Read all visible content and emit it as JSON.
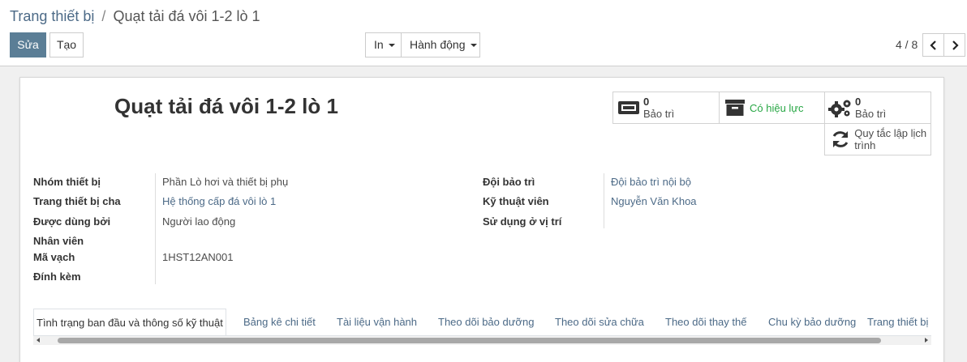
{
  "breadcrumb": {
    "parent": "Trang thiết bị",
    "separator": "/",
    "current": "Quạt tải đá vôi 1-2 lò 1"
  },
  "buttons": {
    "edit": "Sửa",
    "create": "Tạo",
    "print": "In",
    "action": "Hành động"
  },
  "pager": {
    "value": "4 / 8"
  },
  "record": {
    "title": "Quạt tải đá vôi 1-2 lò 1"
  },
  "smart_buttons": {
    "maintenance": {
      "count": "0",
      "label": "Bảo trì"
    },
    "active": {
      "label": "Có hiệu lực"
    },
    "maintenance2": {
      "count": "0",
      "label": "Bảo trì"
    },
    "schedule": {
      "label": "Quy tắc lập lịch trình"
    }
  },
  "fields_left": [
    {
      "label": "Nhóm thiết bị",
      "value": "Phần Lò hơi và thiết bị phụ"
    },
    {
      "label": "Trang thiết bị cha",
      "value": "Hệ thống cấp đá vôi lò 1"
    },
    {
      "label": "Được dùng bởi",
      "value": "Người lao động"
    },
    {
      "label": "Nhân viên",
      "value": ""
    },
    {
      "label": "Mã vạch",
      "value": "1HST12AN001"
    },
    {
      "label": "Đính kèm",
      "value": ""
    }
  ],
  "fields_right": [
    {
      "label": "Đội bảo trì",
      "value": "Đội bảo trì nội bộ"
    },
    {
      "label": "Kỹ thuật viên",
      "value": "Nguyễn Văn Khoa"
    },
    {
      "label": "Sử dụng ở vị trí",
      "value": ""
    }
  ],
  "tabs": [
    "Tình trạng ban đầu và thông số kỹ thuật",
    "Bảng kê chi tiết",
    "Tài liệu vận hành",
    "Theo dõi bảo dưỡng",
    "Theo dõi sửa chữa",
    "Theo dõi thay thế",
    "Chu kỳ bảo dưỡng",
    "Trang thiết bị"
  ],
  "colors": {
    "primary": "#5b7e96",
    "link": "#4c6a87",
    "success": "#28a745"
  }
}
